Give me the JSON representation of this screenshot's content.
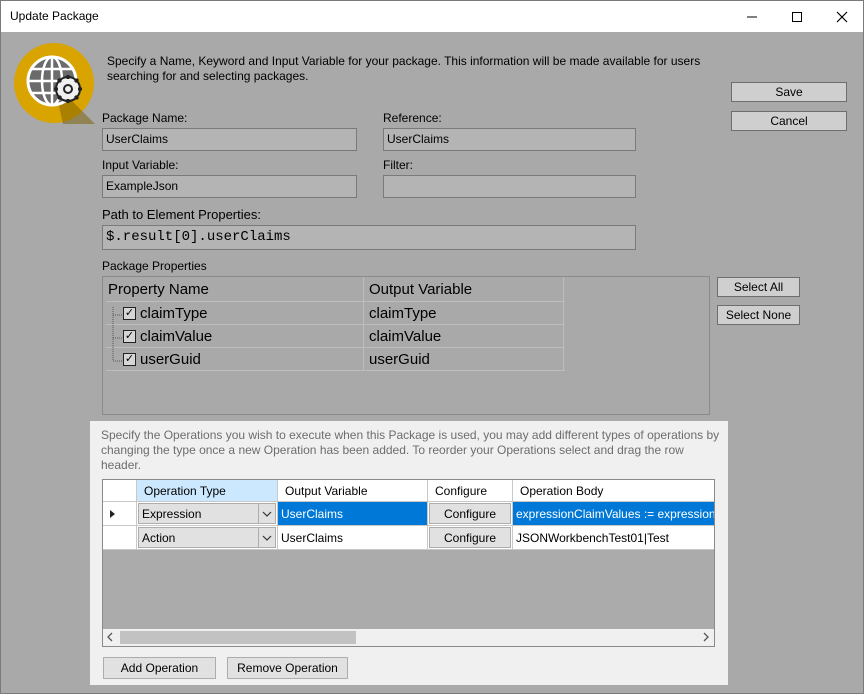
{
  "window": {
    "title": "Update Package"
  },
  "intro_text": "Specify a Name, Keyword and Input Variable for your package. This information will be made available for users searching for and selecting packages.",
  "buttons": {
    "save": "Save",
    "cancel": "Cancel",
    "select_all": "Select All",
    "select_none": "Select None",
    "add_operation": "Add Operation",
    "remove_operation": "Remove Operation"
  },
  "fields": {
    "package_name": {
      "label": "Package Name:",
      "value": "UserClaims"
    },
    "reference": {
      "label": "Reference:",
      "value": "UserClaims"
    },
    "input_variable": {
      "label": "Input Variable:",
      "value": "ExampleJson"
    },
    "filter": {
      "label": "Filter:",
      "value": ""
    },
    "path": {
      "label": "Path to Element Properties:",
      "value": "$.result[0].userClaims"
    }
  },
  "package_properties": {
    "label": "Package Properties",
    "columns": [
      "Property Name",
      "Output Variable"
    ],
    "rows": [
      {
        "name": "claimType",
        "output": "claimType",
        "checked": true
      },
      {
        "name": "claimValue",
        "output": "claimValue",
        "checked": true
      },
      {
        "name": "userGuid",
        "output": "userGuid",
        "checked": true
      }
    ]
  },
  "operations": {
    "description": "Specify the Operations you wish to execute when this Package is used, you may add different types of operations by changing the type once a new Operation has been added. To reorder your Operations select and drag the row header.",
    "columns": [
      "Operation Type",
      "Output Variable",
      "Configure",
      "Operation Body"
    ],
    "rows": [
      {
        "type": "Expression",
        "output": "UserClaims",
        "configure": "Configure",
        "body": "expressionClaimValues := expressionC",
        "selected": true
      },
      {
        "type": "Action",
        "output": "UserClaims",
        "configure": "Configure",
        "body": "JSONWorkbenchTest01|Test",
        "selected": false
      }
    ]
  },
  "icons": {
    "window_controls": [
      "close-icon",
      "maximize-icon",
      "minimize-icon"
    ],
    "logo": "globe-gear-icon"
  },
  "colors": {
    "selection": "#0078d7",
    "logo_ring": "#d9a300",
    "dialog_bg": "#a9a9a9"
  }
}
